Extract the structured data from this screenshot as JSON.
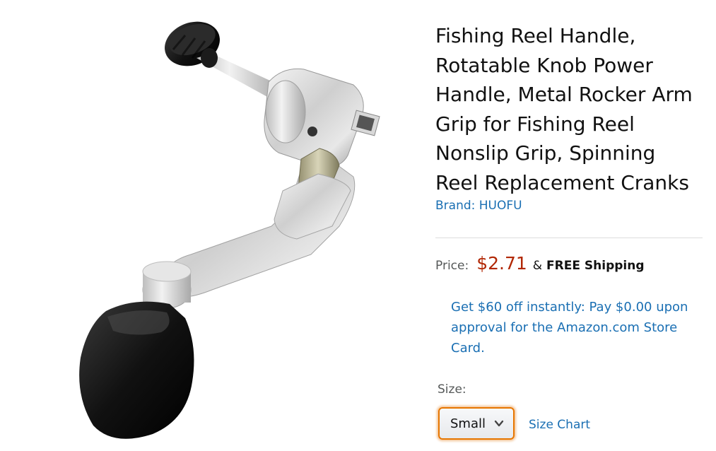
{
  "product": {
    "title": "Fishing Reel Handle, Rotatable Knob Power Handle, Metal Rocker Arm Grip for Fishing Reel Nonslip Grip, Spinning Reel Replacement Cranks",
    "brand": "Brand: HUOFU",
    "image_name": "fishing-reel-handle-image"
  },
  "price": {
    "label": "Price:",
    "value": "$2.71",
    "ampersand": "&",
    "shipping": "FREE Shipping",
    "color": "#b12704"
  },
  "promo": {
    "text": "Get $60 off instantly: Pay $0.00 upon approval for the Amazon.com Store Card."
  },
  "size": {
    "label": "Size:",
    "selected": "Small",
    "size_chart_link": "Size Chart"
  },
  "colors": {
    "link": "#1a6fb3",
    "select_focus": "#e77600"
  }
}
